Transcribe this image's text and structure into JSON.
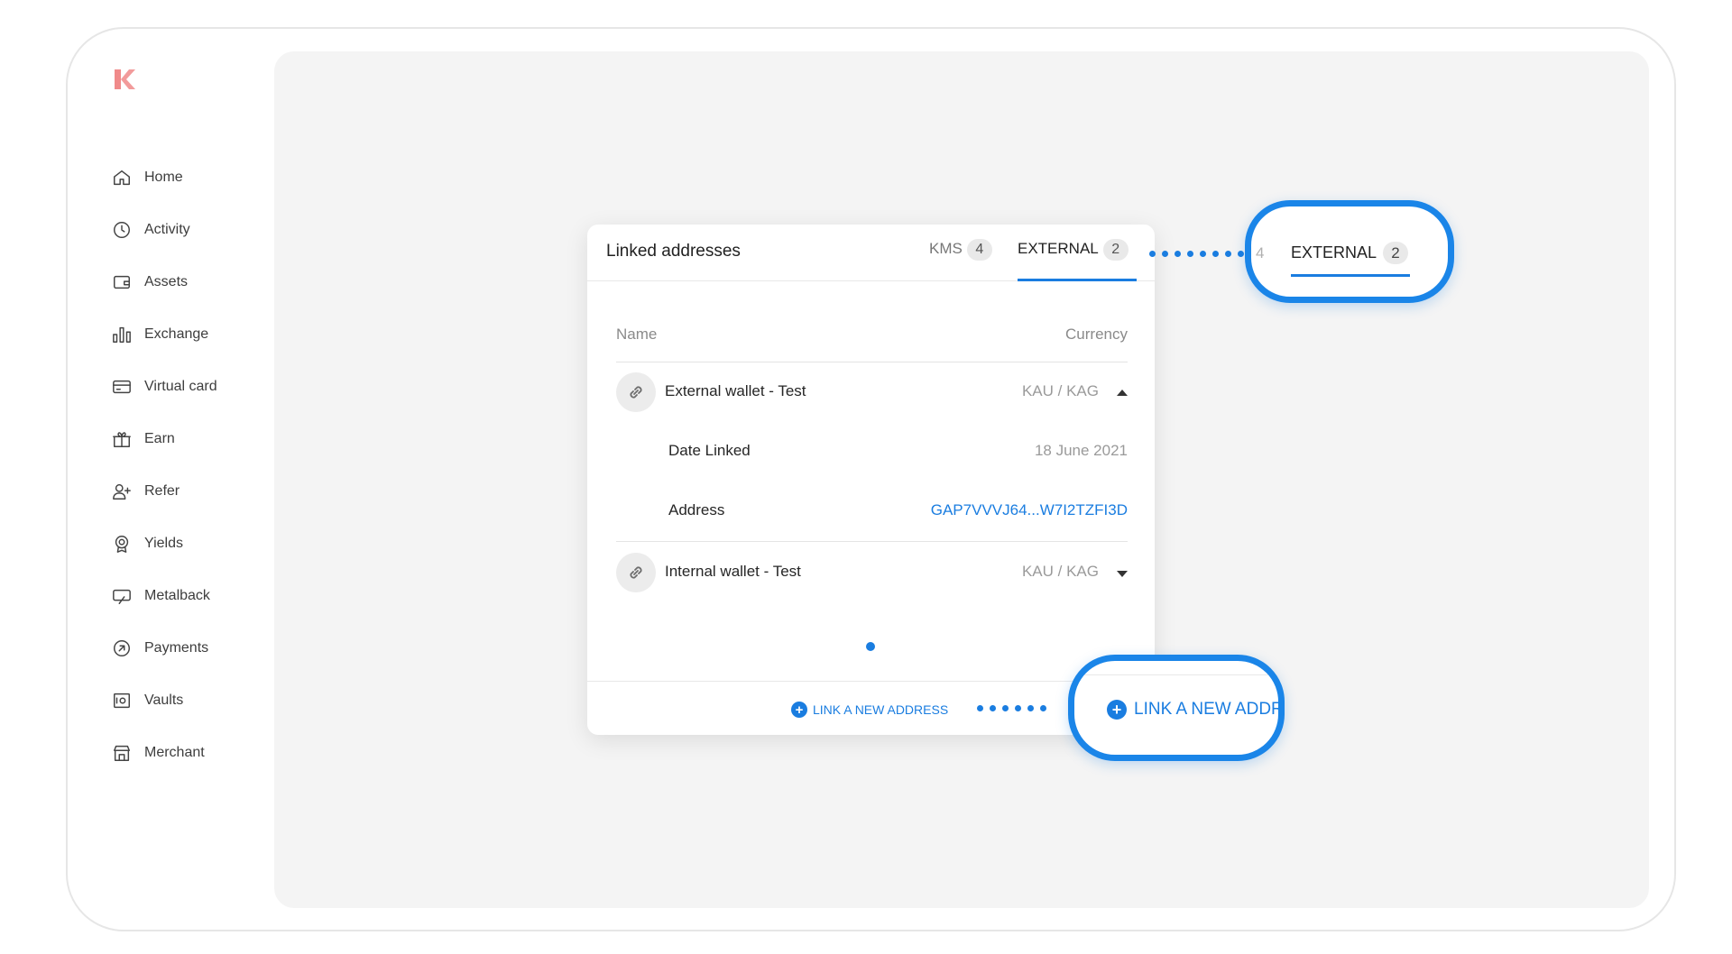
{
  "sidebar": {
    "logo_letter": "K",
    "items": [
      {
        "label": "Home",
        "icon": "home-icon"
      },
      {
        "label": "Activity",
        "icon": "clock-icon"
      },
      {
        "label": "Assets",
        "icon": "wallet-icon"
      },
      {
        "label": "Exchange",
        "icon": "bar-chart-icon"
      },
      {
        "label": "Virtual card",
        "icon": "card-icon"
      },
      {
        "label": "Earn",
        "icon": "gift-icon"
      },
      {
        "label": "Refer",
        "icon": "user-plus-icon"
      },
      {
        "label": "Yields",
        "icon": "badge-icon"
      },
      {
        "label": "Metalback",
        "icon": "cashback-icon"
      },
      {
        "label": "Payments",
        "icon": "arrow-circle-icon"
      },
      {
        "label": "Vaults",
        "icon": "vault-icon"
      },
      {
        "label": "Merchant",
        "icon": "store-icon"
      }
    ]
  },
  "card": {
    "title": "Linked addresses",
    "tabs": {
      "kms": {
        "label": "KMS",
        "count": "4"
      },
      "external": {
        "label": "EXTERNAL",
        "count": "2"
      }
    },
    "columns": {
      "name": "Name",
      "currency": "Currency"
    },
    "rows": [
      {
        "name": "External wallet - Test",
        "currency": "KAU / KAG",
        "details": [
          {
            "label": "Date Linked",
            "value": "18 June 2021"
          },
          {
            "label": "Address",
            "value": "GAP7VVVJ64...W7I2TZFI3D"
          }
        ]
      },
      {
        "name": "Internal wallet - Test",
        "currency": "KAU / KAG"
      }
    ],
    "link_button": "LINK A NEW ADDRESS"
  },
  "callouts": {
    "tab_zoom": {
      "ghost": "4",
      "label": "EXTERNAL",
      "count": "2"
    },
    "link_zoom": {
      "label": "LINK A NEW ADDR"
    }
  },
  "colors": {
    "accent": "#1a7de0",
    "logo": "#f08a8a",
    "content_bg": "#f4f4f4"
  }
}
